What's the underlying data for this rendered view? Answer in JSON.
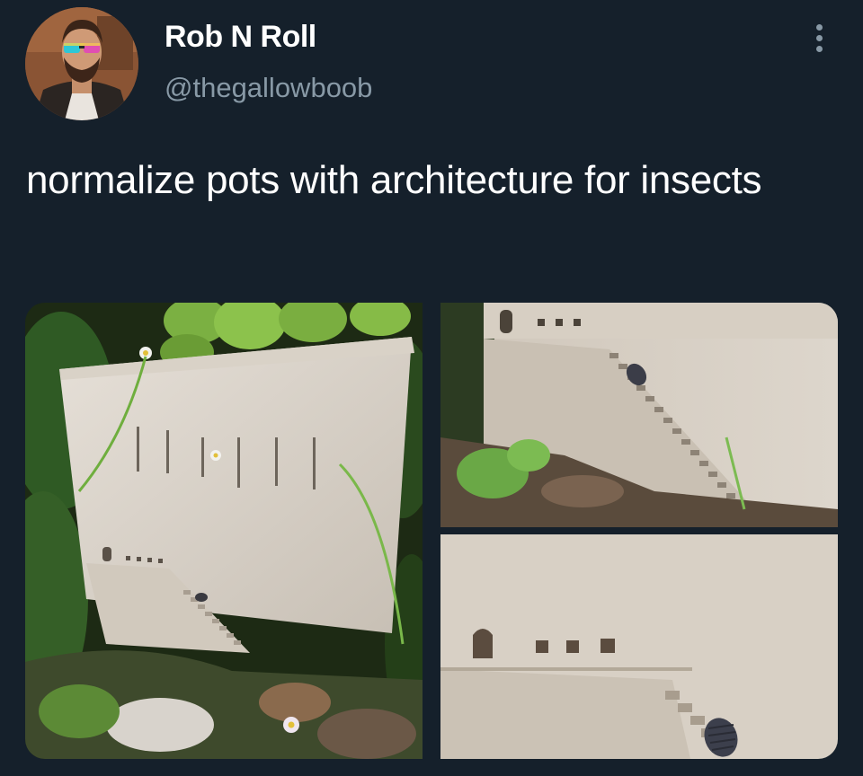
{
  "author": {
    "display_name": "Rob N Roll",
    "handle": "@thegallowboob",
    "avatar_icon": "avatar-photo"
  },
  "tweet": {
    "text": "normalize pots with architecture for insects"
  },
  "actions": {
    "more_icon": "more-vertical-icon"
  },
  "media": {
    "count": 3,
    "items": [
      {
        "name": "photo-pot-with-plants"
      },
      {
        "name": "photo-staircase-closeup-top"
      },
      {
        "name": "photo-staircase-closeup-bottom"
      }
    ]
  },
  "colors": {
    "background": "#15202b",
    "text_primary": "#ffffff",
    "text_secondary": "#8899a6"
  }
}
